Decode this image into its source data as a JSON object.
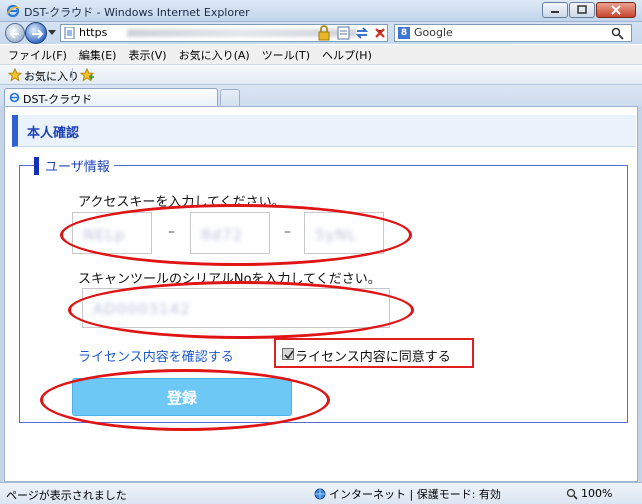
{
  "window": {
    "title": "DST-クラウド - Windows Internet Explorer",
    "address_prefix": "https",
    "search_provider": "Google"
  },
  "menu": [
    "ファイル(F)",
    "編集(E)",
    "表示(V)",
    "お気に入り(A)",
    "ツール(T)",
    "ヘルプ(H)"
  ],
  "favorites": {
    "label": "お気に入り"
  },
  "tab": {
    "label": "DST-クラウド"
  },
  "page": {
    "title": "本人確認",
    "section_title": "ユーザ情報",
    "access_key_label": "アクセスキーを入力してください。",
    "access_key_parts": [
      "NELp",
      "8d72",
      "5yNL"
    ],
    "dash": "–",
    "serial_label": "スキャンツールのシリアルNoを入力してください。",
    "serial_value": "AD0003142",
    "license_link": "ライセンス内容を確認する",
    "agree_label": "ライセンス内容に同意する",
    "agree_checked": true,
    "register_button": "登録"
  },
  "status": {
    "message": "ページが表示されました",
    "zone": "インターネット | 保護モード: 有効",
    "zoom": "100%"
  },
  "colors": {
    "accent": "#2f5fd0",
    "heading": "#1f43b8",
    "link": "#1f5bc8",
    "button": "#6ec8f5",
    "annotation": "#e01414"
  }
}
